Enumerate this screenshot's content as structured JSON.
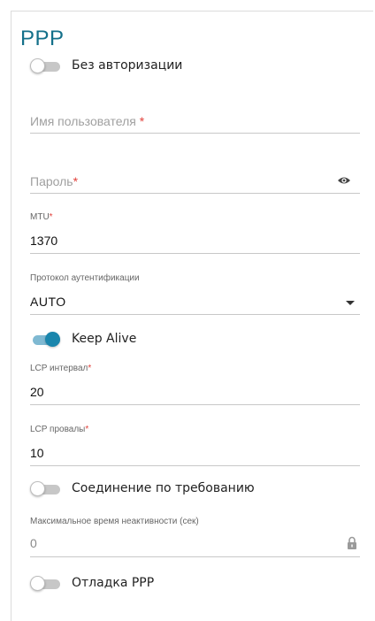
{
  "section": {
    "title": "PPP"
  },
  "no_auth": {
    "label": "Без авторизации",
    "on": false
  },
  "username": {
    "placeholder": "Имя пользователя",
    "required_mark": "*"
  },
  "password": {
    "placeholder": "Пароль",
    "required_mark": "*",
    "icon": "eye-icon"
  },
  "mtu": {
    "label": "MTU",
    "required_mark": "*",
    "value": "1370"
  },
  "auth_protocol": {
    "label": "Протокол аутентификации",
    "value": "AUTO"
  },
  "keep_alive": {
    "label": "Keep Alive",
    "on": true
  },
  "lcp_interval": {
    "label": "LCP интервал",
    "required_mark": "*",
    "value": "20"
  },
  "lcp_failures": {
    "label": "LCP провалы",
    "required_mark": "*",
    "value": "10"
  },
  "on_demand": {
    "label": "Соединение по требованию",
    "on": false
  },
  "idle_time": {
    "label": "Максимальное время неактивности (сек)",
    "value": "0",
    "icon": "lock-icon"
  },
  "ppp_debug": {
    "label": "Отладка PPP",
    "on": false
  },
  "colors": {
    "accent": "#1a86ad",
    "title": "#14708a",
    "required": "#e2423c"
  }
}
